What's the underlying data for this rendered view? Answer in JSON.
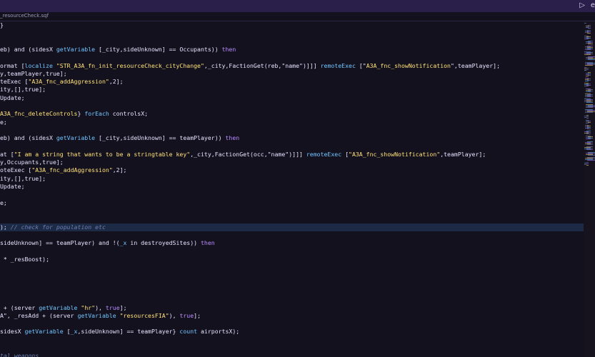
{
  "window": {
    "run_icon": "▷",
    "more_icon": "e"
  },
  "tab": {
    "label": "_resourceCheck.sqf"
  },
  "code_lines": [
    {
      "t": "}",
      "c": "pl"
    },
    {
      "t": "",
      "c": "pl"
    },
    {
      "t": "",
      "c": "pl"
    },
    {
      "parts": [
        [
          "eb) and (sidesX ",
          "pl"
        ],
        [
          "getVariable",
          "fn"
        ],
        [
          " [_city,sideUnknown] == Occupants)) ",
          "pl"
        ],
        [
          "then",
          "kw"
        ]
      ]
    },
    {
      "t": "",
      "c": "pl"
    },
    {
      "parts": [
        [
          "ormat [",
          "pl"
        ],
        [
          "localize",
          "fn"
        ],
        [
          " \"STR_A3A_fn_init_resourceCheck_cityChange\"",
          "str"
        ],
        [
          ",_city,FactionGet(reb,\"name\")]]] ",
          "pl"
        ],
        [
          "remoteExec",
          "fn"
        ],
        [
          " [\"",
          "pl"
        ],
        [
          "A3A_fnc_showNotification",
          "str"
        ],
        [
          "\",teamPlayer];",
          "pl"
        ]
      ]
    },
    {
      "parts": [
        [
          "y,teamPlayer,true];",
          "pl"
        ]
      ]
    },
    {
      "parts": [
        [
          "teExec [",
          "pl"
        ],
        [
          "\"A3A_fnc_addAggression\"",
          "str"
        ],
        [
          ",2];",
          "pl"
        ]
      ]
    },
    {
      "parts": [
        [
          "ity,[],true];",
          "pl"
        ]
      ]
    },
    {
      "parts": [
        [
          "Update;",
          "pl"
        ]
      ]
    },
    {
      "t": "",
      "c": "pl"
    },
    {
      "parts": [
        [
          "A3A_fnc_deleteControls",
          "str"
        ],
        [
          "} ",
          "pl"
        ],
        [
          "forEach",
          "fn"
        ],
        [
          " controlsX;",
          "pl"
        ]
      ]
    },
    {
      "parts": [
        [
          "e;",
          "pl"
        ]
      ]
    },
    {
      "t": "",
      "c": "pl"
    },
    {
      "parts": [
        [
          "eb) and (sidesX ",
          "pl"
        ],
        [
          "getVariable",
          "fn"
        ],
        [
          " [_city,sideUnknown] == teamPlayer)) ",
          "pl"
        ],
        [
          "then",
          "kw"
        ]
      ]
    },
    {
      "t": "",
      "c": "pl"
    },
    {
      "parts": [
        [
          "at [",
          "pl"
        ],
        [
          "\"I am a string that wants to be a stringtable key\"",
          "str"
        ],
        [
          ",_city,FactionGet(occ,\"name\")]]] ",
          "pl"
        ],
        [
          "remoteExec",
          "fn"
        ],
        [
          " [",
          "pl"
        ],
        [
          "\"A3A_fnc_showNotification\"",
          "str"
        ],
        [
          ",teamPlayer];",
          "pl"
        ]
      ]
    },
    {
      "parts": [
        [
          "y,Occupants,true];",
          "pl"
        ]
      ]
    },
    {
      "parts": [
        [
          "oteExec [",
          "pl"
        ],
        [
          "\"A3A_fnc_addAggression\"",
          "str"
        ],
        [
          ",2];",
          "pl"
        ]
      ]
    },
    {
      "parts": [
        [
          "ity,[],true];",
          "pl"
        ]
      ]
    },
    {
      "parts": [
        [
          "Update;",
          "pl"
        ]
      ]
    },
    {
      "t": "",
      "c": "pl"
    },
    {
      "parts": [
        [
          "e;",
          "pl"
        ]
      ]
    },
    {
      "t": "",
      "c": "pl"
    },
    {
      "t": "",
      "c": "pl"
    },
    {
      "parts": [
        [
          "); ",
          "pl"
        ],
        [
          "// check for population ",
          "cm"
        ],
        [
          "etc",
          "cm"
        ]
      ],
      "highlight": true
    },
    {
      "t": "",
      "c": "pl"
    },
    {
      "parts": [
        [
          "sideUnknown] == teamPlayer) and !(",
          "pl"
        ],
        [
          "_x",
          "fn"
        ],
        [
          " in destroyedSites)) ",
          "pl"
        ],
        [
          "then",
          "kw"
        ]
      ]
    },
    {
      "t": "",
      "c": "pl"
    },
    {
      "parts": [
        [
          " * _resBoost);",
          "pl"
        ]
      ]
    },
    {
      "t": "",
      "c": "pl"
    },
    {
      "t": "",
      "c": "pl"
    },
    {
      "t": "",
      "c": "pl"
    },
    {
      "t": "",
      "c": "pl"
    },
    {
      "t": "",
      "c": "pl"
    },
    {
      "parts": [
        [
          " + (server ",
          "pl"
        ],
        [
          "getVariable",
          "fn"
        ],
        [
          " \"hr\"",
          "str"
        ],
        [
          "), ",
          "pl"
        ],
        [
          "true",
          "kw"
        ],
        [
          "];",
          "pl"
        ]
      ]
    },
    {
      "parts": [
        [
          "A\", _resAdd + (server ",
          "pl"
        ],
        [
          "getVariable",
          "fn"
        ],
        [
          " \"resourcesFIA\"",
          "str"
        ],
        [
          "), ",
          "pl"
        ],
        [
          "true",
          "kw"
        ],
        [
          "];",
          "pl"
        ]
      ]
    },
    {
      "t": "",
      "c": "pl"
    },
    {
      "parts": [
        [
          "sidesX ",
          "pl"
        ],
        [
          "getVariable",
          "fn"
        ],
        [
          " [",
          "pl"
        ],
        [
          "_x",
          "fn"
        ],
        [
          ",sideUnknown] == teamPlayer} ",
          "pl"
        ],
        [
          "count",
          "fn"
        ],
        [
          " airportsX);",
          "pl"
        ]
      ]
    },
    {
      "t": "",
      "c": "pl"
    },
    {
      "t": "",
      "c": "pl"
    },
    {
      "parts": [
        [
          "tal weapons",
          "cm"
        ]
      ]
    }
  ],
  "colors": {
    "background": "#13111e",
    "titlebar": "#2a1f4a",
    "keyword": "#b88cff",
    "function": "#73c5ff",
    "string": "#ffe178",
    "comment": "#6a7fb3",
    "highlight_line": "#1d2a45"
  }
}
